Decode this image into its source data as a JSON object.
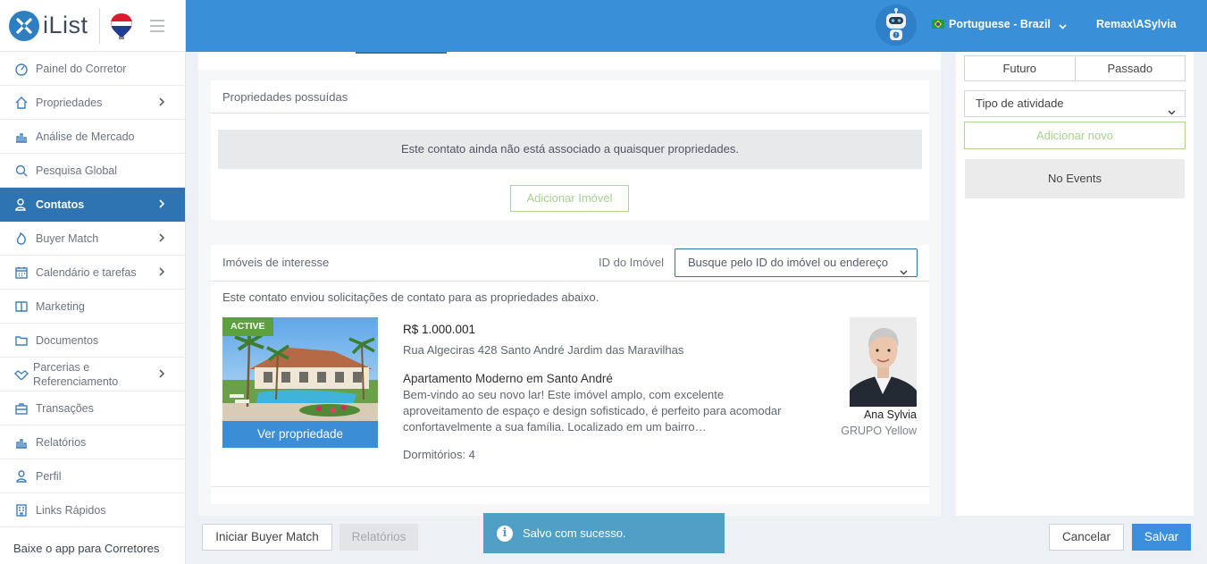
{
  "app": {
    "logo_text": "iList"
  },
  "topbar": {
    "language": "Portuguese - Brazil",
    "user": "Remax\\ASylvia"
  },
  "sidebar": {
    "items": [
      {
        "label": "Painel do Corretor",
        "icon": "dashboard-icon"
      },
      {
        "label": "Propriedades",
        "icon": "home-icon"
      },
      {
        "label": "Análise de Mercado",
        "icon": "bar-chart-icon"
      },
      {
        "label": "Pesquisa Global",
        "icon": "search-icon"
      },
      {
        "label": "Contatos",
        "icon": "contacts-icon"
      },
      {
        "label": "Buyer Match",
        "icon": "flame-icon"
      },
      {
        "label": "Calendário e tarefas",
        "icon": "calendar-icon"
      },
      {
        "label": "Marketing",
        "icon": "book-icon"
      },
      {
        "label": "Documentos",
        "icon": "folder-icon"
      },
      {
        "label_line1": "Parcerias e",
        "label_line2": "Referenciamento",
        "icon": "handshake-icon"
      },
      {
        "label": "Transações",
        "icon": "briefcase-icon"
      },
      {
        "label": "Relatórios",
        "icon": "report-chart-icon"
      },
      {
        "label": "Perfil",
        "icon": "user-icon"
      },
      {
        "label": "Links Rápidos",
        "icon": "building-icon"
      }
    ],
    "footer": "Baixe o app para Corretores"
  },
  "owned": {
    "title": "Propriedades possuídas",
    "empty_notice": "Este contato ainda não está associado a quaisquer propriedades.",
    "add_button": "Adicionar Imóvel"
  },
  "interest": {
    "title": "Imóveis de interesse",
    "id_label": "ID do Imóvel",
    "search_placeholder": "Busque pelo ID do imóvel ou endereço",
    "intro": "Este contato enviou solicitações de contato para as propriedades abaixo.",
    "listing": {
      "status": "ACTIVE",
      "price": "R$ 1.000.001",
      "address": "Rua Algeciras 428 Santo André Jardim das Maravilhas",
      "title": "Apartamento Moderno em Santo André",
      "description": "Bem-vindo ao seu novo lar! Este imóvel amplo, com excelente aproveitamento de espaço e design sofisticado, é perfeito para acomodar confortavelmente a sua família. Localizado em um bairro…",
      "bedrooms": "Dormitórios: 4",
      "view_button": "Ver propriedade",
      "agent_name": "Ana Sylvia",
      "agent_group": "GRUPO Yellow"
    }
  },
  "activity": {
    "future": "Futuro",
    "past": "Passado",
    "type_select": "Tipo de atividade",
    "add_new": "Adicionar novo",
    "no_events": "No Events"
  },
  "footer": {
    "buyer_match": "Iniciar Buyer Match",
    "reports": "Relatórios",
    "cancel": "Cancelar",
    "save": "Salvar"
  },
  "toast": {
    "message": "Salvo com sucesso."
  },
  "colors": {
    "primary": "#3a8fd9",
    "active_nav": "#2e74b3",
    "success_badge": "#5da13e",
    "toast": "#4f9fc6"
  }
}
